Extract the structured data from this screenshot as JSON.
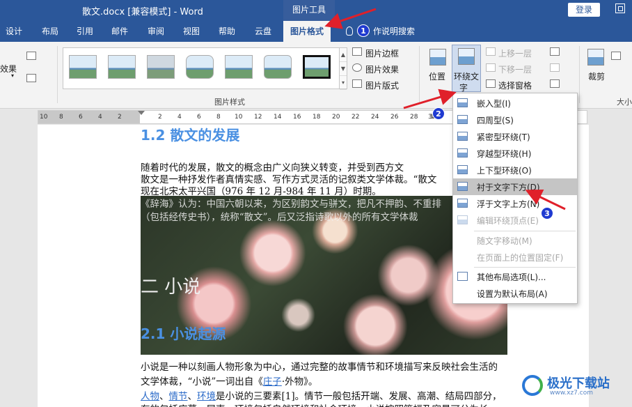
{
  "window": {
    "title": "散文.docx [兼容模式] - Word",
    "context_tab_group": "图片工具",
    "login_label": "登录"
  },
  "tabs": [
    "设计",
    "布局",
    "引用",
    "邮件",
    "审阅",
    "视图",
    "帮助",
    "云盘"
  ],
  "active_tab": "图片格式",
  "tell_me": "作说明搜索",
  "ribbon": {
    "left_partial_label": "效果",
    "left_partial_arrow": "▾",
    "gallery_group_label": "图片样式",
    "picture_border": "图片边框",
    "picture_effects": "图片效果",
    "picture_layout": "图片版式",
    "position": "位置",
    "wrap_text_line1": "环绕文",
    "wrap_text_line2": "字",
    "bring_forward": "上移一层",
    "send_backward": "下移一层",
    "selection_pane": "选择窗格",
    "crop": "裁剪",
    "size_group_partial": "大小"
  },
  "ruler_ticks": [
    "10",
    "8",
    "6",
    "4",
    "2",
    "2",
    "4",
    "6",
    "8",
    "10",
    "12",
    "14",
    "16",
    "18",
    "20",
    "22",
    "24",
    "26",
    "28",
    "30",
    "32",
    "46",
    "48"
  ],
  "document": {
    "heading_1_2": "1.2 散文的发展",
    "para1_line1": "随着时代的发展，散文的概念由广义向狭义转变，并受到西方文",
    "para1_line2": "散文是一种抒发作者真情实感、写作方式灵活的记叙类文学体裁。“散文",
    "para1_line3": "现在北宋太平兴国（976 年 12 月-984 年 11 月）时期。",
    "overlay_line1": "《辞海》认为：中国六朝以来，为区别韵文与骈文，把凡不押韵、不重排",
    "overlay_line2": "（包括经传史书），统称“散文”。后又泛指诗歌以外的所有文学体裁",
    "overlay_big_heading": "二 小说",
    "overlay_heading_2_1": "2.1 小说起源",
    "para2_line1": "小说是一种以刻画人物形象为中心，通过完整的故事情节和环境描写来反映社会生活的",
    "para2_line2_a": "文学体裁，“小说”一词出自《",
    "para2_link_zhuangzi": "庄子",
    "para2_line2_b": "·外物》。",
    "para3_link_renwu": "人物",
    "para3_sep1": "、",
    "para3_link_qingjie": "情节",
    "para3_sep2": "、",
    "para3_link_huanjing": "环境",
    "para3_rest": "是小说的三要素[1]。情节一般包括开端、发展、高潮、结局四部分，",
    "para4_partial": "有的包括序幕、尾声。环境包括自然环境和社会环境。小说按照篇幅及容量可分为长"
  },
  "wrap_menu": {
    "items": [
      {
        "label": "嵌入型(I)",
        "disabled": false
      },
      {
        "label": "四周型(S)",
        "disabled": false
      },
      {
        "label": "紧密型环绕(T)",
        "disabled": false
      },
      {
        "label": "穿越型环绕(H)",
        "disabled": false
      },
      {
        "label": "上下型环绕(O)",
        "disabled": false
      },
      {
        "label": "衬于文字下方(D)",
        "disabled": false,
        "highlighted": true
      },
      {
        "label": "浮于文字上方(N)",
        "disabled": false
      },
      {
        "label": "编辑环绕顶点(E)",
        "disabled": true
      },
      {
        "label": "随文字移动(M)",
        "disabled": true
      },
      {
        "label": "在页面上的位置固定(F)",
        "disabled": true
      },
      {
        "label": "其他布局选项(L)...",
        "disabled": false
      },
      {
        "label": "设置为默认布局(A)",
        "disabled": false
      }
    ]
  },
  "annotations": {
    "badge_1": "1",
    "badge_2": "2",
    "badge_3": "3",
    "arrow_color": "#e0202a",
    "badge_color": "#1f3ad1"
  },
  "watermark": {
    "text": "极光下载站",
    "sub": "www.xz7.com"
  },
  "colors": {
    "title_bar": "#2b579a",
    "heading_blue": "#4a90e2",
    "menu_highlight": "#c5c5c5"
  }
}
